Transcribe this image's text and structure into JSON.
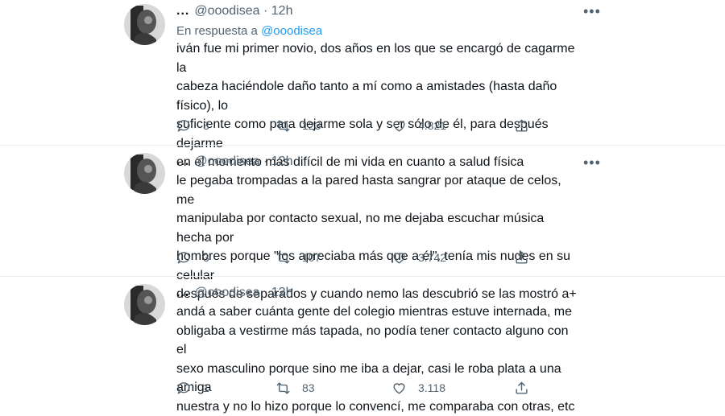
{
  "tweets": [
    {
      "handle_prefix": "...",
      "handle": "@ooodisea",
      "separator": "·",
      "time": "12h",
      "more_label": "•••",
      "reply_prefix": "En respuesta a",
      "reply_handle": "@ooodisea",
      "lines": [
        "iván fue mi primer novio, dos años en los que se encargó de cagarme la",
        "cabeza haciéndole daño tanto a mí como a amistades (hasta daño físico), lo",
        "suficiente como para dejarme sola y ser sólo de él, para después dejarme",
        "en el momento más difícil de mi vida en cuanto a salud física"
      ],
      "replies": "3",
      "retweets": "123",
      "likes": "4.821"
    },
    {
      "handle_prefix": "...",
      "handle": "@ooodisea",
      "separator": "·",
      "time": "12h",
      "more_label": "•••",
      "lines": [
        "le pegaba trompadas a la pared hasta sangrar por ataque de celos, me",
        "manipulaba por contacto sexual, no me dejaba escuchar música hecha por",
        "hombres porque \"los apreciaba más que a él\", tenía mis nudes en su celular",
        "después de separados y cuando nemo las descubrió se las mostró a+"
      ],
      "replies": "3",
      "retweets": "107",
      "likes": "3.742"
    },
    {
      "handle_prefix": "...",
      "handle": "@ooodisea",
      "separator": "·",
      "time": "12h",
      "lines": [
        "andá a saber cuánta gente del colegio mientras estuve internada, me",
        "obligaba a vestirme más tapada, no podía tener contacto alguno con el",
        "sexo masculino porque sino me iba a dejar, casi le roba plata a una amiga",
        "nuestra y no lo hizo porque lo convencí, me comparaba con otras, etc"
      ],
      "replies": "1",
      "retweets": "83",
      "likes": "3.118"
    }
  ],
  "icons": {
    "reply": "reply-icon",
    "retweet": "retweet-icon",
    "like": "heart-icon",
    "share": "share-icon",
    "more": "more-icon"
  },
  "colors": {
    "text": "#0f1419",
    "secondary": "#536471",
    "mention": "#1d9bf0",
    "divider": "#e6ecf0"
  }
}
